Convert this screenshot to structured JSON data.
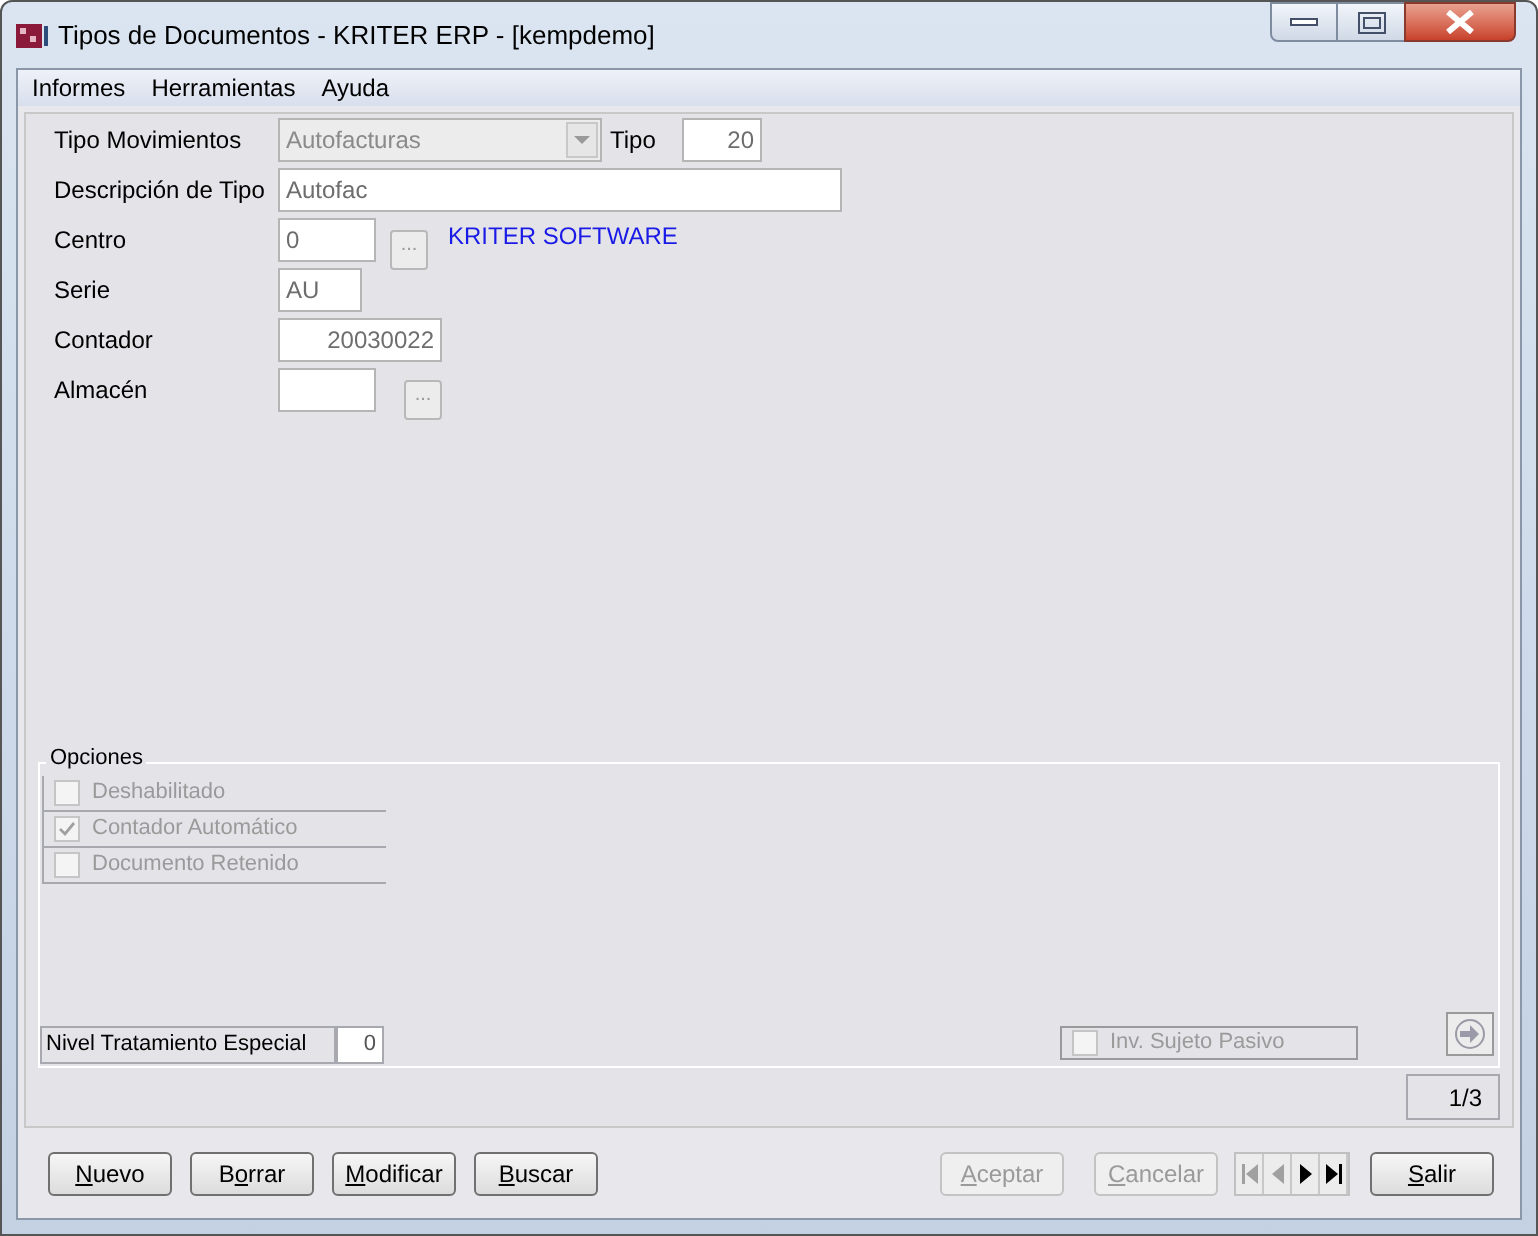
{
  "window": {
    "title": "Tipos de Documentos - KRITER ERP - [kempdemo]"
  },
  "menu": [
    "Informes",
    "Herramientas",
    "Ayuda"
  ],
  "form": {
    "tipo_movimientos": {
      "label": "Tipo Movimientos",
      "value": "Autofacturas",
      "disabled": true
    },
    "tipo": {
      "label": "Tipo",
      "value": "20"
    },
    "descripcion": {
      "label": "Descripción de Tipo",
      "value": "Autofac"
    },
    "centro": {
      "label": "Centro",
      "value": "0",
      "browse": "...",
      "name": "KRITER SOFTWARE"
    },
    "serie": {
      "label": "Serie",
      "value": "AU"
    },
    "contador": {
      "label": "Contador",
      "value": "20030022"
    },
    "almacen": {
      "label": "Almacén",
      "browse": "..."
    }
  },
  "options": {
    "title": "Opciones",
    "items": [
      {
        "label": "Deshabilitado",
        "checked": false,
        "disabled": true
      },
      {
        "label": "Contador Automático",
        "checked": true,
        "disabled": true
      },
      {
        "label": "Documento Retenido",
        "checked": false,
        "disabled": true
      }
    ],
    "nivel": {
      "label": "Nivel Tratamiento Especial",
      "value": "0"
    },
    "inv_sujeto_pasivo": {
      "label": "Inv. Sujeto Pasivo",
      "checked": false,
      "disabled": true
    }
  },
  "pager": "1/3",
  "buttons": [
    {
      "key": "N",
      "post": "uevo",
      "disabled": false
    },
    {
      "pre": "B",
      "key": "o",
      "post": "rrar",
      "disabled": false
    },
    {
      "key": "M",
      "post": "odificar",
      "disabled": false
    },
    {
      "key": "B",
      "post": "uscar",
      "disabled": false
    }
  ],
  "right_buttons": [
    {
      "key": "A",
      "post": "ceptar",
      "disabled": true
    },
    {
      "key": "C",
      "post": "ancelar",
      "disabled": true
    }
  ],
  "nav": [
    {
      "kind": "first",
      "disabled": true
    },
    {
      "kind": "prev",
      "disabled": true
    },
    {
      "kind": "next",
      "disabled": false
    },
    {
      "kind": "last",
      "disabled": false
    }
  ],
  "exit_button": {
    "key": "S",
    "post": "alir",
    "disabled": false
  }
}
